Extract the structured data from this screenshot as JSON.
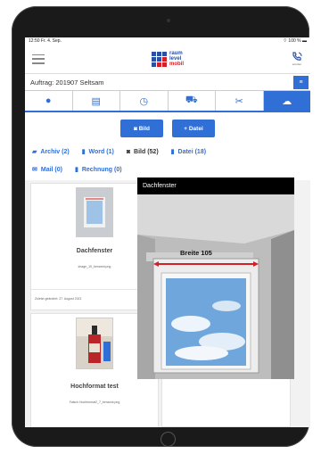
{
  "status": {
    "time": "12:50",
    "date": "Fr. 4. Sep.",
    "battery": "100 %"
  },
  "header": {
    "logo_lines": [
      "raum",
      "level",
      "mobil"
    ],
    "phone_label": "anrufen"
  },
  "auftrag": {
    "label": "Auftrag: 201907 Seltsam",
    "button": "≡"
  },
  "tabs": [
    {
      "icon": "info-icon",
      "active": false
    },
    {
      "icon": "document-icon",
      "active": false
    },
    {
      "icon": "clock-icon",
      "active": false
    },
    {
      "icon": "truck-icon",
      "active": false
    },
    {
      "icon": "tools-icon",
      "active": false
    },
    {
      "icon": "cloud-icon",
      "active": true
    }
  ],
  "actions": {
    "bild": "Bild",
    "datei": "+ Datei"
  },
  "filters": {
    "archiv": "Archiv (2)",
    "word": "Word (1)",
    "bild": "Bild (52)",
    "datei": "Datei (18)",
    "mail": "Mail (0)",
    "rechnung": "Rechnung (0)"
  },
  "cards": [
    {
      "title": "Dachfenster",
      "file": "image_19_benannt.png",
      "date": "Zuletzt geändert: 27. August 2021"
    },
    {
      "title": "Hochformat test",
      "file": "Falsch Hochformat2_7_benannt.png"
    }
  ],
  "viewer": {
    "title": "Dachfenster",
    "annotation": "Breite 105"
  },
  "colors": {
    "accent": "#2f6fd6",
    "brand_blue": "#2a4fa3",
    "brand_red": "#d32027"
  }
}
